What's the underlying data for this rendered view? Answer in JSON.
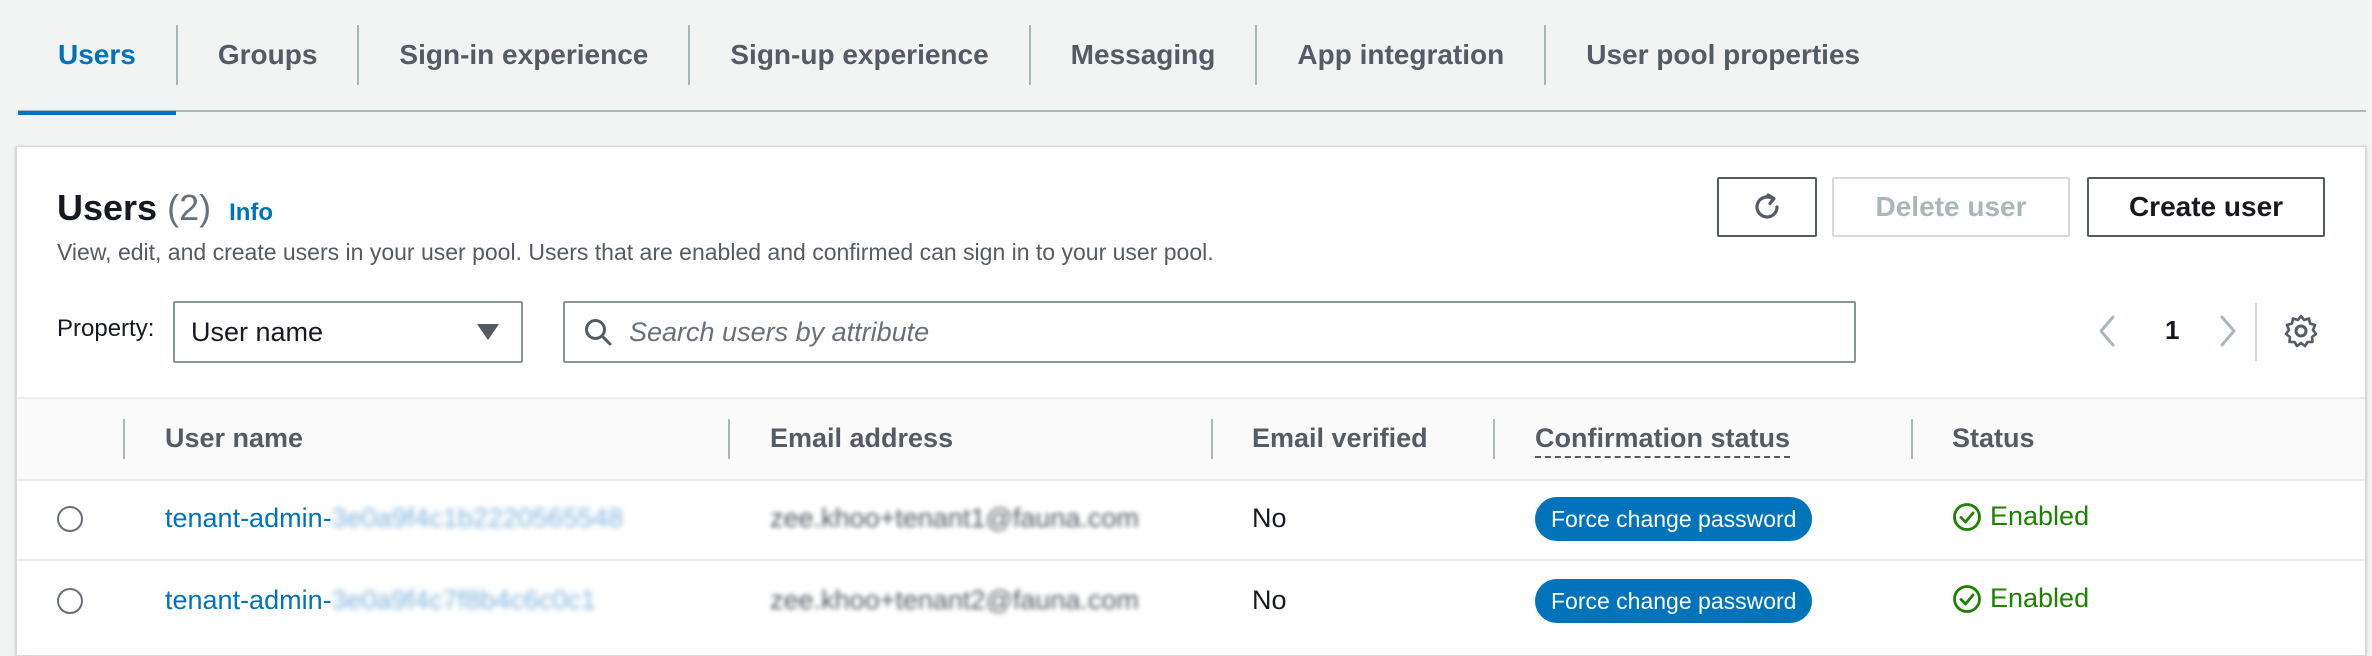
{
  "tabs": [
    {
      "label": "Users",
      "active": true
    },
    {
      "label": "Groups"
    },
    {
      "label": "Sign-in experience"
    },
    {
      "label": "Sign-up experience"
    },
    {
      "label": "Messaging"
    },
    {
      "label": "App integration"
    },
    {
      "label": "User pool properties"
    }
  ],
  "header": {
    "title": "Users",
    "count": "(2)",
    "info": "Info",
    "description": "View, edit, and create users in your user pool. Users that are enabled and confirmed can sign in to your user pool."
  },
  "actions": {
    "refresh_icon": "refresh-icon",
    "delete_label": "Delete user",
    "create_label": "Create user"
  },
  "filter": {
    "property_label": "Property:",
    "property_value": "User name",
    "search_placeholder": "Search users by attribute"
  },
  "pagination": {
    "page": "1"
  },
  "table": {
    "columns": [
      "User name",
      "Email address",
      "Email verified",
      "Confirmation status",
      "Status"
    ],
    "rows": [
      {
        "username_prefix": "tenant-admin-",
        "username_blurred": "3e0a9f4c1b2220565548",
        "email_blurred_prefix": "zee.khoo+tenant1@fauna.com",
        "email_verified": "No",
        "confirmation": "Force change password",
        "status": "Enabled"
      },
      {
        "username_prefix": "tenant-admin-",
        "username_blurred": "3e0a9f4c7f8b4c6c0c1",
        "email_blurred_prefix": "zee.khoo+tenant2@fauna.com",
        "email_verified": "No",
        "confirmation": "Force change password",
        "status": "Enabled"
      }
    ]
  },
  "colors": {
    "accent": "#0073bb",
    "success": "#1d8102"
  }
}
